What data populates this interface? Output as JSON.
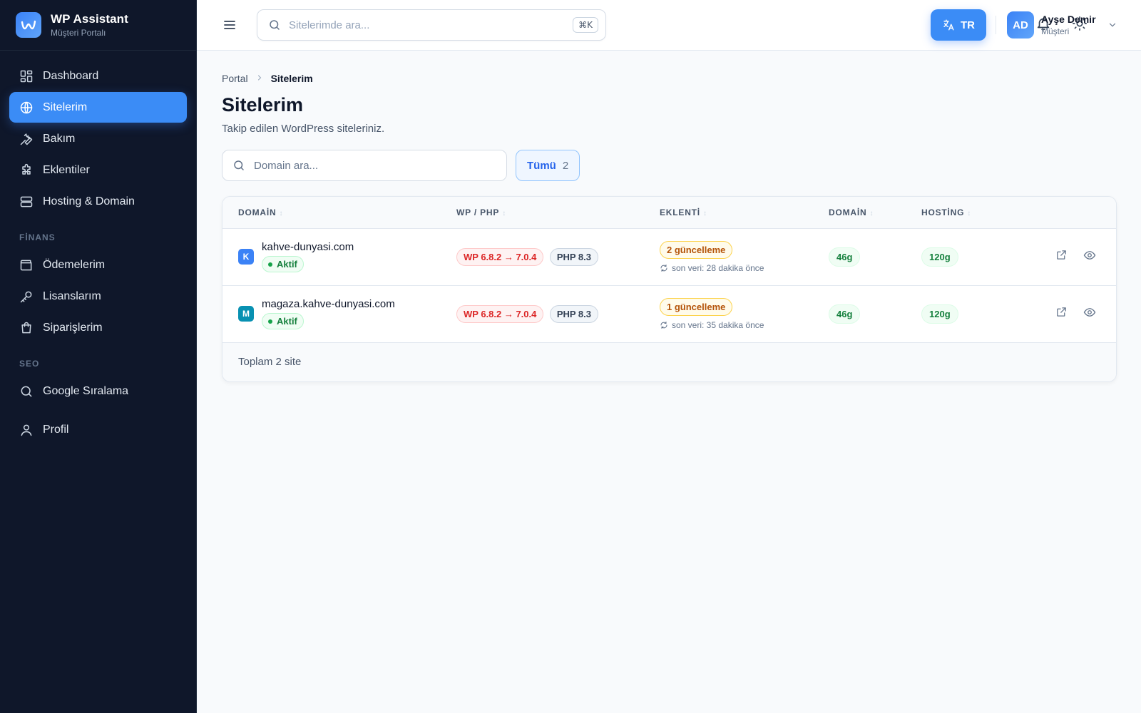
{
  "brand": {
    "title": "WP Assistant",
    "subtitle": "Müşteri Portalı"
  },
  "sidebar": {
    "main": [
      {
        "label": "Dashboard",
        "icon": "dashboard-icon",
        "active": false
      },
      {
        "label": "Sitelerim",
        "icon": "globe-icon",
        "active": true
      },
      {
        "label": "Bakım",
        "icon": "wrench-icon",
        "active": false
      },
      {
        "label": "Eklentiler",
        "icon": "puzzle-icon",
        "active": false
      },
      {
        "label": "Hosting & Domain",
        "icon": "server-icon",
        "active": false
      }
    ],
    "finance_title": "FİNANS",
    "finance": [
      {
        "label": "Ödemelerim",
        "icon": "wallet-icon"
      },
      {
        "label": "Lisanslarım",
        "icon": "key-icon"
      },
      {
        "label": "Siparişlerim",
        "icon": "shopping-bag-icon"
      }
    ],
    "seo_title": "SEO",
    "seo": [
      {
        "label": "Google Sıralama",
        "icon": "search-icon"
      }
    ],
    "profile": {
      "label": "Profil",
      "icon": "user-icon"
    }
  },
  "topbar": {
    "search_placeholder": "Sitelerimde ara...",
    "shortcut": "⌘K",
    "lang": "TR",
    "user": {
      "initials": "AD",
      "name": "Ayşe Demir",
      "role": "Müşteri"
    }
  },
  "breadcrumb": {
    "root": "Portal",
    "current": "Sitelerim"
  },
  "page": {
    "title": "Sitelerim",
    "subtitle": "Takip edilen WordPress siteleriniz."
  },
  "filters": {
    "search_placeholder": "Domain ara...",
    "chip_label": "Tümü",
    "chip_count": "2"
  },
  "table": {
    "headers": [
      "DOMAİN",
      "WP / PHP",
      "EKLENTİ",
      "DOMAİN",
      "HOSTİNG"
    ],
    "rows": [
      {
        "letter": "K",
        "letter_color": "#3b82f6",
        "domain": "kahve-dunyasi.com",
        "status": "Aktif",
        "wp": "WP 6.8.2 → 7.0.4",
        "php": "PHP 8.3",
        "updates": "2 güncelleme",
        "last_data": "son veri: 28 dakika önce",
        "domain_days": "46g",
        "hosting_days": "120g"
      },
      {
        "letter": "M",
        "letter_color": "#0891b2",
        "domain": "magaza.kahve-dunyasi.com",
        "status": "Aktif",
        "wp": "WP 6.8.2 → 7.0.4",
        "php": "PHP 8.3",
        "updates": "1 güncelleme",
        "last_data": "son veri: 35 dakika önce",
        "domain_days": "46g",
        "hosting_days": "120g"
      }
    ],
    "footer": "Toplam 2 site"
  },
  "colors": {
    "accent": "#3b8cf6",
    "sidebar_bg": "#0f172a"
  }
}
